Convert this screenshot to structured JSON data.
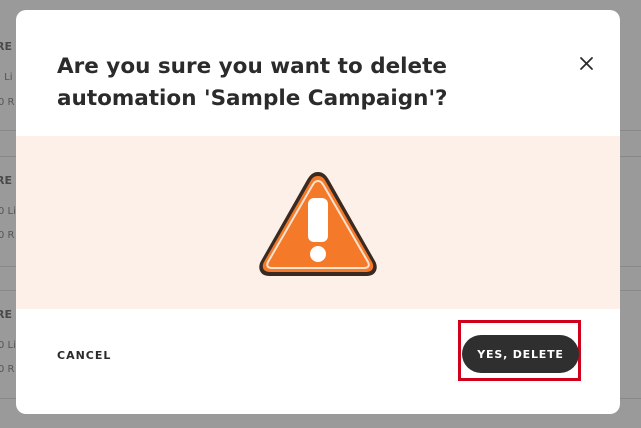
{
  "background": {
    "rows": [
      {
        "title": "RE",
        "line1": "I Li",
        "line2": "0 R"
      },
      {
        "title": "RE",
        "line1": "0 Li",
        "line2": "0 R"
      },
      {
        "title": "RE",
        "line1": "0 Li",
        "line2": "0 R"
      }
    ]
  },
  "dialog": {
    "title": "Are you sure you want to delete automation 'Sample Campaign'?",
    "close_icon": "close-icon",
    "warning_icon": "warning-triangle-icon",
    "cancel_label": "CANCEL",
    "confirm_label": "YES, DELETE"
  },
  "colors": {
    "warning_panel": "#fdf0e8",
    "warning_orange": "#f47a2a",
    "confirm_button": "#2f2f2f",
    "highlight": "#d0021b"
  }
}
